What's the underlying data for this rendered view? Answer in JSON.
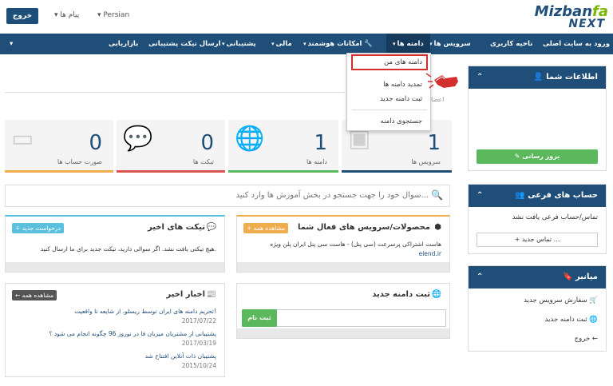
{
  "topbar": {
    "logout_label": "خروج",
    "messages_label": "پیام ها",
    "language_label": "Persian",
    "logo_line1_a": "Mizban",
    "logo_line1_b": "fa",
    "logo_line2": "NEXT"
  },
  "nav": {
    "items": [
      {
        "label": "ورود به سایت اصلی"
      },
      {
        "label": "ناحیه کاربری"
      },
      {
        "label": "سرویس ها"
      },
      {
        "label": "دامنه ها"
      },
      {
        "label": "امکانات هوشمند"
      },
      {
        "label": "مالی"
      },
      {
        "label": "پشتیبانی"
      },
      {
        "label": "ارسال تیکت پشتیبانی"
      },
      {
        "label": "بازاریابی"
      }
    ]
  },
  "dropdown": {
    "items": [
      {
        "label": "دامنه های من"
      },
      {
        "label": "تمدید دامنه ها"
      },
      {
        "label": "ثبت دامنه جدید"
      },
      {
        "label": "جستجوی دامنه"
      }
    ]
  },
  "breadcrumb_fragment": "اعضا",
  "stats": [
    {
      "value": "1",
      "label": "سرویس ها",
      "color": "#1f4e79"
    },
    {
      "value": "1",
      "label": "دامنه ها",
      "color": "#5cb85c"
    },
    {
      "value": "0",
      "label": "تیکت ها",
      "color": "#d9534f"
    },
    {
      "value": "0",
      "label": "صورت حساب ها",
      "color": "#f0ad4e"
    }
  ],
  "search": {
    "placeholder": "سوال خود را جهت جستجو در بخش آموزش ها وارد کنید..."
  },
  "products_box": {
    "title": "محصولات/سرویس های فعال شما",
    "tag": "مشاهده همه",
    "line1": "هاست اشتراکی پرسرعت (سی پنل) - هاست سی پنل ایران پلن ویژه",
    "line2": "elend.ir"
  },
  "tickets_box": {
    "title": "تیکت های اخیر",
    "tag": "درخواست جدید",
    "text": "هیچ تیکتی یافت نشد. اگر سوالی دارید، تیکت جدید برای ما ارسال کنید."
  },
  "domain_box": {
    "title": "ثبت دامنه جدید",
    "button": "ثبت نام"
  },
  "news_box": {
    "title": "اخبار اخیر",
    "tag": "مشاهده همه",
    "items": [
      {
        "title": "تحریم دامنه های ایران توسط ریسلو، از شایعه تا واقعیت!",
        "date": "2017/07/22"
      },
      {
        "title": "پشتیبانی از مشتریان میزبان فا در نوروز 96 چگونه انجام می شود ؟",
        "date": "2017/03/19"
      },
      {
        "title": "پشتیبان ذات آنلاین افتتاح شد",
        "date": "2015/10/24"
      }
    ]
  },
  "sidebar": {
    "info_title": "اطلاعات شما",
    "update_button": "بروز رسانی",
    "subaccounts_title": "حساب های فرعی",
    "subaccounts_empty": "تماس/حساب فرعی یافت نشد",
    "new_contact_button": "تماس جدید ...",
    "shortcuts_title": "میانبر",
    "shortcuts": [
      {
        "label": "سفارش سرویس جدید"
      },
      {
        "label": "ثبت دامنه جدید"
      },
      {
        "label": "خروج"
      }
    ]
  }
}
